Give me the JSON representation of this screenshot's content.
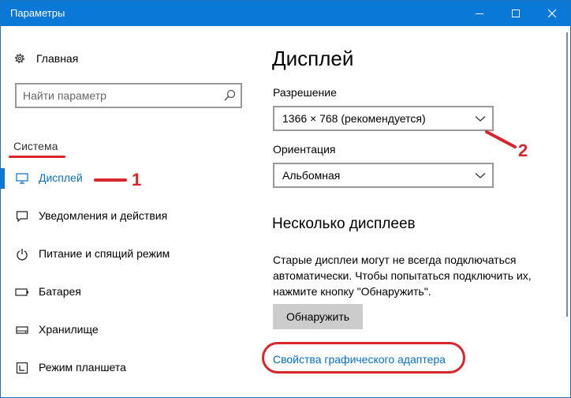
{
  "window": {
    "title": "Параметры"
  },
  "sidebar": {
    "home_label": "Главная",
    "search_placeholder": "Найти параметр",
    "section_label": "Система",
    "items": [
      {
        "label": "Дисплей",
        "icon": "monitor-icon",
        "active": true
      },
      {
        "label": "Уведомления и действия",
        "icon": "notification-icon",
        "active": false
      },
      {
        "label": "Питание и спящий режим",
        "icon": "power-icon",
        "active": false
      },
      {
        "label": "Батарея",
        "icon": "battery-icon",
        "active": false
      },
      {
        "label": "Хранилище",
        "icon": "storage-icon",
        "active": false
      },
      {
        "label": "Режим планшета",
        "icon": "tablet-icon",
        "active": false
      }
    ]
  },
  "main": {
    "title": "Дисплей",
    "resolution_label": "Разрешение",
    "resolution_value": "1366 × 768 (рекомендуется)",
    "orientation_label": "Ориентация",
    "orientation_value": "Альбомная",
    "multi_title": "Несколько дисплеев",
    "multi_desc": "Старые дисплеи могут не всегда подключаться автоматически. Чтобы попытаться подключить их, нажмите кнопку \"Обнаружить\".",
    "detect_label": "Обнаружить",
    "adapter_link": "Свойства графического адаптера"
  },
  "annotations": {
    "num1": "1",
    "num2": "2",
    "color": "#d9262c"
  },
  "colors": {
    "accent": "#0a78d7",
    "link": "#0a6fc2"
  }
}
